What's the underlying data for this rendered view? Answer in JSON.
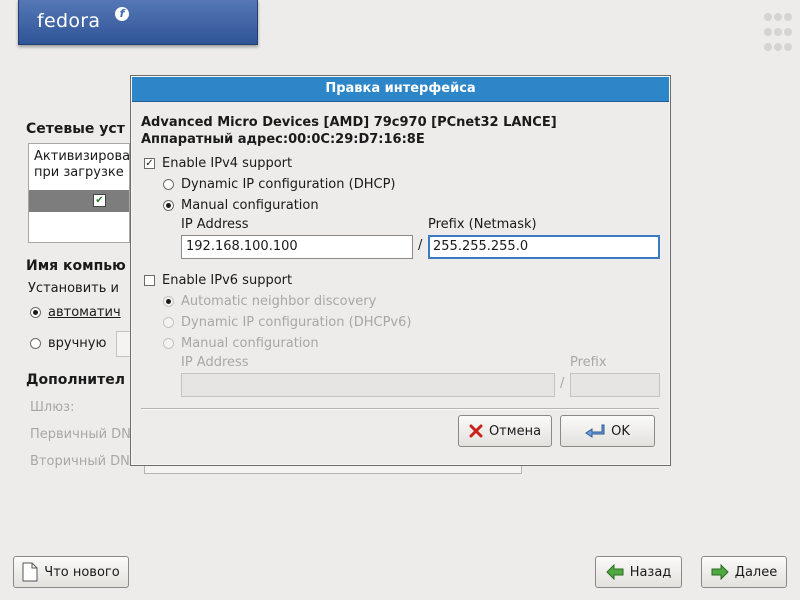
{
  "installer": {
    "logo_text": "fedora",
    "logo_mark": "f",
    "network_devices_heading": "Сетевые уст",
    "device_list_line1": "Активизирова",
    "device_list_line2": "при загрузке",
    "hostname_heading": "Имя компью",
    "set_hostname_label": "Установить и",
    "auto_option": "автоматич",
    "manual_option": "вручную",
    "additional_heading": "Дополнител",
    "gateway_label": "Шлюз:",
    "primary_dns_label": "Первичный DN",
    "secondary_dns_label": "Вторичный DN",
    "release_notes_button": "Что нового",
    "back_button": "Назад",
    "next_button": "Далее"
  },
  "dialog": {
    "title": "Правка интерфейса",
    "device_name": "Advanced Micro Devices [AMD] 79c970 [PCnet32 LANCE]",
    "hw_address": "Аппаратный адрес:00:0C:29:D7:16:8E",
    "ipv4": {
      "enable_label": "Enable IPv4 support",
      "enabled": true,
      "dhcp_label": "Dynamic IP configuration (DHCP)",
      "manual_label": "Manual configuration",
      "ip_label": "IP Address",
      "prefix_label": "Prefix (Netmask)",
      "separator": "/",
      "ip_value": "192.168.100.100",
      "prefix_value": "255.255.255.0"
    },
    "ipv6": {
      "enable_label": "Enable IPv6 support",
      "enabled": false,
      "auto_label": "Automatic neighbor discovery",
      "dhcp_label": "Dynamic IP configuration (DHCPv6)",
      "manual_label": "Manual configuration",
      "ip_label": "IP Address",
      "prefix_label": "Prefix",
      "separator": "/"
    },
    "cancel_button": "Отмена",
    "ok_button": "OK"
  },
  "colors": {
    "title_bar": "#2d86c8",
    "banner": "#3c6eb4",
    "background": "#edeceb"
  }
}
